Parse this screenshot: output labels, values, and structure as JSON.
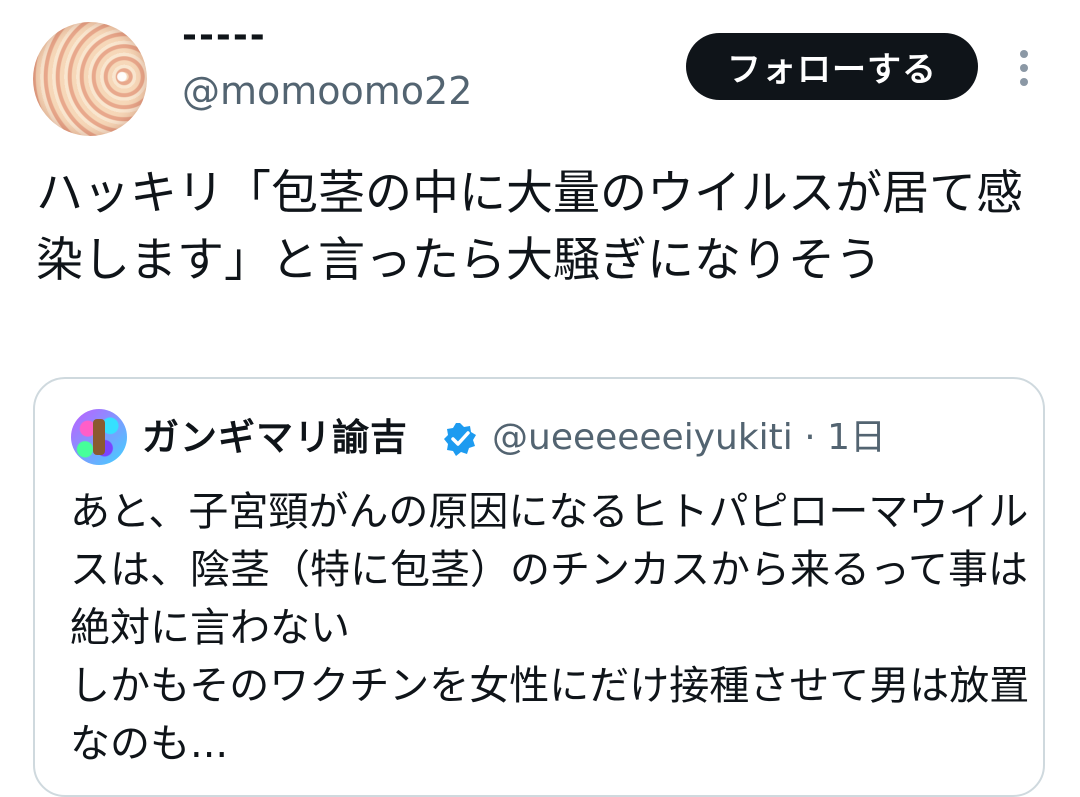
{
  "tweet": {
    "display_name": "-----",
    "handle": "@momoomo22",
    "follow_label": "フォローする",
    "text": "ハッキリ「包茎の中に大量のウイルスが居て感染します」と言ったら大騒ぎになりそう"
  },
  "quoted_tweet": {
    "display_name": "ガンギマリ諭吉",
    "handle_time": "@ueeeeeeiyukiti · 1日",
    "text": "あと、子宮頸がんの原因になるヒトパピローマウイルスは、陰茎（特に包茎）のチンカスから来るって事は絶対に言わない\nしかもそのワクチンを女性にだけ接種させて男は放置なのも..."
  },
  "icons": {
    "more": "more-vertical-icon",
    "verified": "verified-badge-icon"
  },
  "colors": {
    "verified_blue": "#1d9bf0",
    "follow_bg": "#0f1419",
    "secondary_text": "#536471"
  }
}
